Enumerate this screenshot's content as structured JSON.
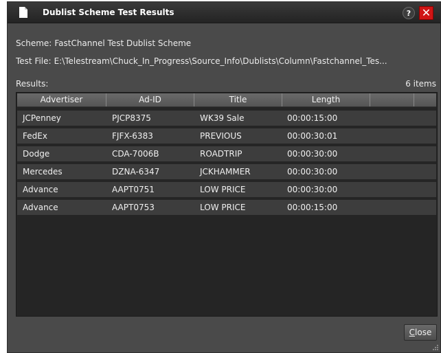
{
  "window": {
    "title": "Dublist Scheme Test Results",
    "help_label": "?",
    "close_glyph": "✕",
    "icons": [
      "document-icon",
      "help-icon",
      "close-icon",
      "resize-grip-icon"
    ]
  },
  "info": {
    "scheme_label": "Scheme:",
    "scheme_value": "FastChannel Test Dublist Scheme",
    "testfile_label": "Test File:",
    "testfile_value": "E:\\Telestream\\Chuck_In_Progress\\Source_Info\\Dublists\\Column\\Fastchannel_Tes..."
  },
  "results": {
    "label": "Results:",
    "count": "6 items",
    "columns": [
      "Advertiser",
      "Ad-ID",
      "Title",
      "Length"
    ],
    "rows": [
      {
        "advertiser": "JCPenney",
        "ad_id": "PJCP8375",
        "title": "WK39 Sale",
        "length": "00:00:15:00"
      },
      {
        "advertiser": "FedEx",
        "ad_id": "FJFX-6383",
        "title": "PREVIOUS",
        "length": "00:00:30:01"
      },
      {
        "advertiser": "Dodge",
        "ad_id": "CDA-7006B",
        "title": "ROADTRIP",
        "length": "00:00:30:00"
      },
      {
        "advertiser": "Mercedes",
        "ad_id": "DZNA-6347",
        "title": "JCKHAMMER",
        "length": "00:00:30:00"
      },
      {
        "advertiser": "Advance",
        "ad_id": "AAPT0751",
        "title": "LOW PRICE",
        "length": "00:00:30:00"
      },
      {
        "advertiser": "Advance",
        "ad_id": "AAPT0753",
        "title": "LOW PRICE",
        "length": "00:00:15:00"
      }
    ]
  },
  "footer": {
    "close_label_first": "C",
    "close_label_rest": "lose"
  },
  "colors": {
    "window_bg": "#4a4a4a",
    "list_bg": "#252525",
    "row_bg": "#3d3d3d",
    "close_red": "#d01515"
  }
}
